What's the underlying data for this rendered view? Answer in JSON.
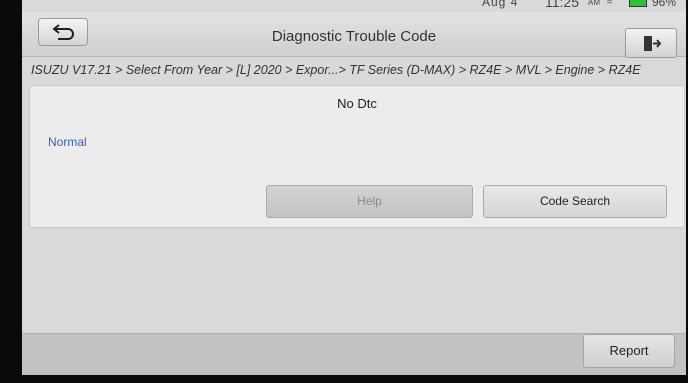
{
  "status_bar": {
    "text": "Aug 4",
    "time": "11:25",
    "ampm": "AM",
    "battery": "96%",
    "icons": [
      "wifi-icon",
      "battery-icon"
    ]
  },
  "header": {
    "title": "Diagnostic Trouble Code",
    "back_icon": "back-arrow-icon",
    "exit_icon": "exit-door-icon"
  },
  "breadcrumb": "ISUZU V17.21 > Select From Year > [L] 2020 > Expor...> TF Series (D-MAX) > RZ4E > MVL > Engine > RZ4E",
  "panel": {
    "title": "No Dtc",
    "status": "Normal",
    "help_label": "Help",
    "code_search_label": "Code Search"
  },
  "footer": {
    "report_label": "Report"
  },
  "colors": {
    "status_text": "#3b5fb8",
    "battery": "#2bc23a"
  }
}
